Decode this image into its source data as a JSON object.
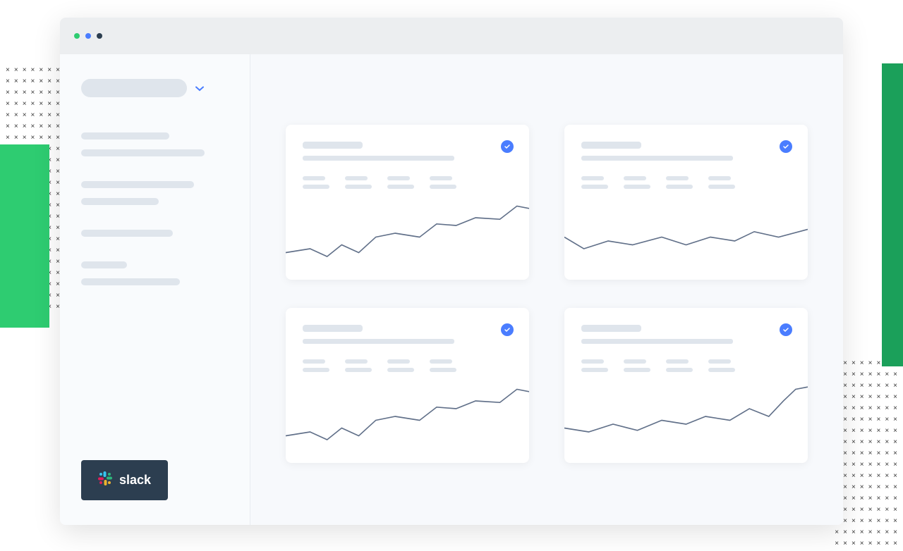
{
  "decorations": {
    "x_symbol": "×"
  },
  "browser": {
    "dots": [
      "green",
      "blue",
      "dark"
    ]
  },
  "sidebar": {
    "selector_label": "",
    "groups": [
      {
        "items": [
          {
            "w": "w1"
          },
          {
            "w": "w2"
          }
        ]
      },
      {
        "items": [
          {
            "w": "w3"
          },
          {
            "w": "w4"
          }
        ]
      },
      {
        "items": [
          {
            "w": "w5"
          }
        ]
      },
      {
        "items": [
          {
            "w": "w6"
          },
          {
            "w": "w7"
          }
        ]
      }
    ],
    "integration_label": "slack"
  },
  "cards": [
    {
      "checked": true,
      "chart": "up"
    },
    {
      "checked": true,
      "chart": "flat"
    },
    {
      "checked": true,
      "chart": "up"
    },
    {
      "checked": true,
      "chart": "sharp"
    }
  ],
  "chart_data": [
    {
      "type": "line",
      "x": [
        0,
        0.1,
        0.17,
        0.23,
        0.3,
        0.37,
        0.45,
        0.55,
        0.62,
        0.7,
        0.78,
        0.88,
        0.95,
        1.0
      ],
      "values": [
        35,
        40,
        30,
        45,
        35,
        55,
        60,
        55,
        72,
        70,
        80,
        78,
        95,
        92
      ],
      "ylim": [
        0,
        100
      ]
    },
    {
      "type": "line",
      "x": [
        0,
        0.08,
        0.18,
        0.28,
        0.4,
        0.5,
        0.6,
        0.7,
        0.78,
        0.88,
        1.0
      ],
      "values": [
        55,
        40,
        50,
        45,
        55,
        45,
        55,
        50,
        62,
        55,
        65
      ],
      "ylim": [
        0,
        100
      ]
    },
    {
      "type": "line",
      "x": [
        0,
        0.1,
        0.17,
        0.23,
        0.3,
        0.37,
        0.45,
        0.55,
        0.62,
        0.7,
        0.78,
        0.88,
        0.95,
        1.0
      ],
      "values": [
        35,
        40,
        30,
        45,
        35,
        55,
        60,
        55,
        72,
        70,
        80,
        78,
        95,
        92
      ],
      "ylim": [
        0,
        100
      ]
    },
    {
      "type": "line",
      "x": [
        0,
        0.1,
        0.2,
        0.3,
        0.4,
        0.5,
        0.58,
        0.68,
        0.76,
        0.84,
        0.9,
        0.95,
        1.0
      ],
      "values": [
        45,
        40,
        50,
        42,
        55,
        50,
        60,
        55,
        70,
        60,
        80,
        95,
        98
      ],
      "ylim": [
        0,
        100
      ]
    }
  ]
}
